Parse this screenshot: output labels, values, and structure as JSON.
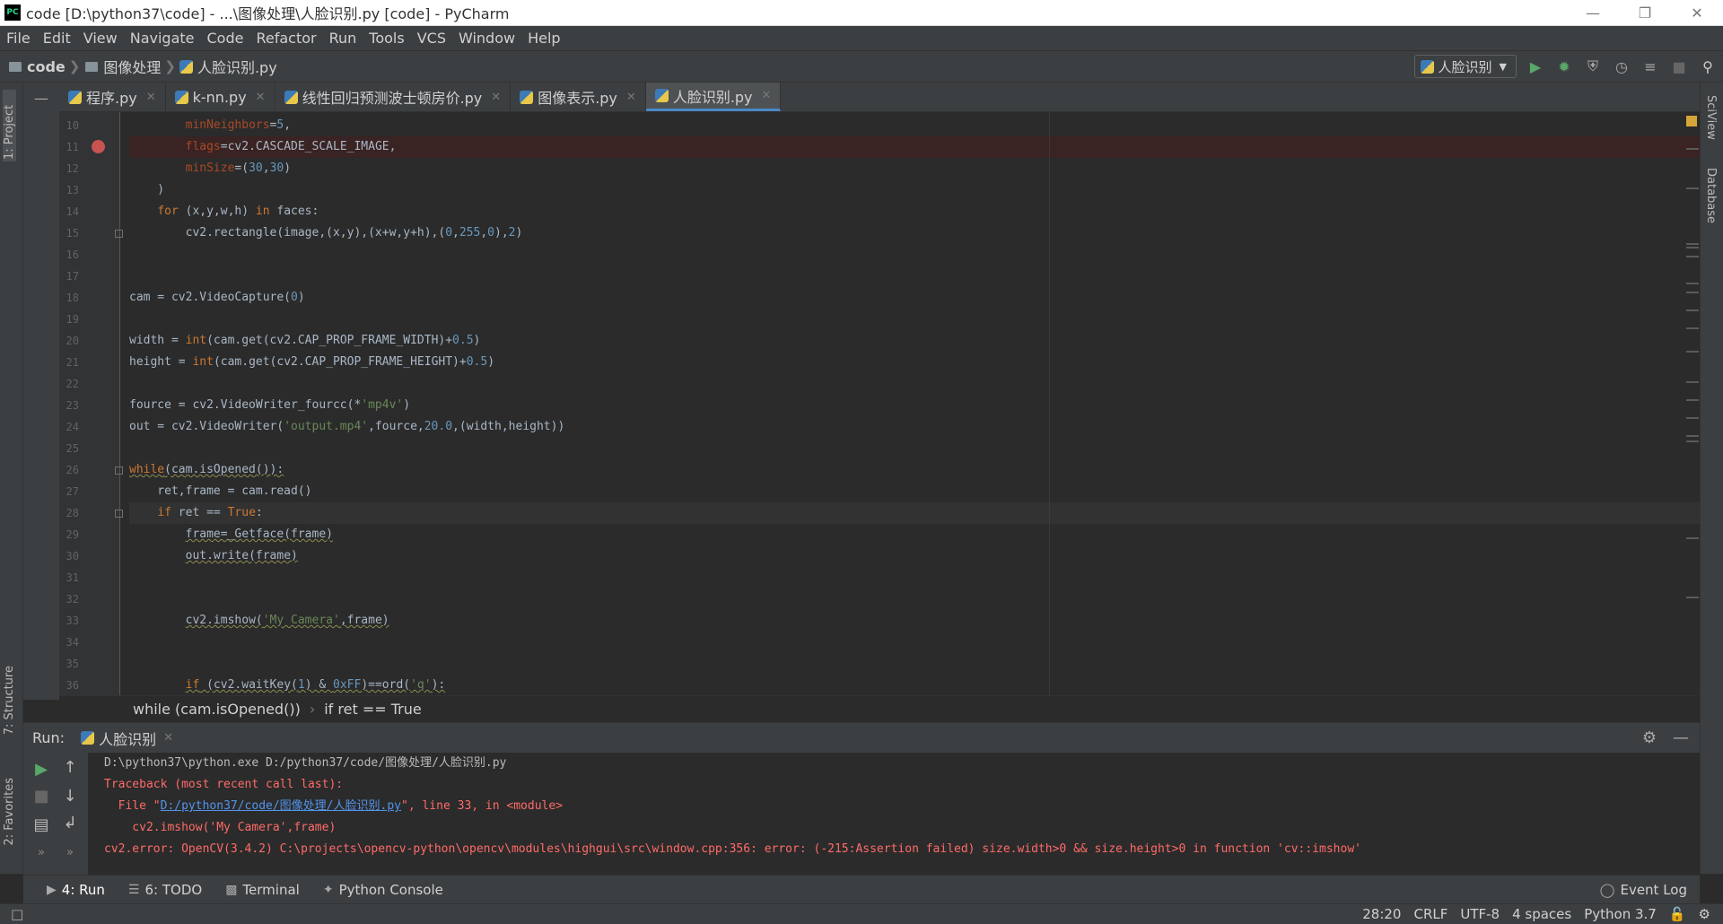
{
  "window": {
    "title": "code [D:\\python37\\code] - ...\\图像处理\\人脸识别.py [code] - PyCharm",
    "logo_text": "PC"
  },
  "menu": [
    "File",
    "Edit",
    "View",
    "Navigate",
    "Code",
    "Refactor",
    "Run",
    "Tools",
    "VCS",
    "Window",
    "Help"
  ],
  "nav": {
    "project": "code",
    "folder": "图像处理",
    "file": "人脸识别.py",
    "run_config": "人脸识别"
  },
  "left_tools": {
    "project": "1: Project",
    "structure": "7: Structure",
    "favorites": "2: Favorites"
  },
  "right_tools": {
    "sciview": "SciView",
    "database": "Database"
  },
  "tabs": [
    {
      "label": "程序.py",
      "active": false
    },
    {
      "label": "k-nn.py",
      "active": false
    },
    {
      "label": "线性回归预测波士顿房价.py",
      "active": false
    },
    {
      "label": "图像表示.py",
      "active": false
    },
    {
      "label": "人脸识别.py",
      "active": true
    }
  ],
  "editor": {
    "line_numbers": [
      "10",
      "11",
      "12",
      "13",
      "14",
      "15",
      "16",
      "17",
      "18",
      "19",
      "20",
      "21",
      "22",
      "23",
      "24",
      "25",
      "26",
      "27",
      "28",
      "29",
      "30",
      "31",
      "32",
      "33",
      "34",
      "35",
      "36"
    ],
    "lines": [
      "        minNeighbors=5,",
      "        flags=cv2.CASCADE_SCALE_IMAGE,",
      "        minSize=(30,30)",
      "    )",
      "    for (x,y,w,h) in faces:",
      "        cv2.rectangle(image,(x,y),(x+w,y+h),(0,255,0),2)",
      "",
      "",
      "cam = cv2.VideoCapture(0)",
      "",
      "width = int(cam.get(cv2.CAP_PROP_FRAME_WIDTH)+0.5)",
      "height = int(cam.get(cv2.CAP_PROP_FRAME_HEIGHT)+0.5)",
      "",
      "fource = cv2.VideoWriter_fourcc(*'mp4v')",
      "out = cv2.VideoWriter('output.mp4',fource,20.0,(width,height))",
      "",
      "while(cam.isOpened()):",
      "    ret,frame = cam.read()",
      "    if ret == True:",
      "        frame=_Getface(frame)",
      "        out.write(frame)",
      "",
      "",
      "        cv2.imshow('My Camera',frame)",
      "",
      "",
      "        if (cv2.waitKey(1) & 0xFF)==ord('q'):"
    ]
  },
  "breadcrumb": [
    "while (cam.isOpened())",
    "if ret == True"
  ],
  "run": {
    "label": "Run:",
    "tab": "人脸识别",
    "console": [
      "D:\\python37\\python.exe D:/python37/code/图像处理/人脸识别.py",
      "Traceback (most recent call last):",
      "  File \"",
      "D:/python37/code/图像处理/人脸识别.py",
      "\", line 33, in <module>",
      "    cv2.imshow('My Camera',frame)",
      "cv2.error: OpenCV(3.4.2) C:\\projects\\opencv-python\\opencv\\modules\\highgui\\src\\window.cpp:356: error: (-215:Assertion failed) size.width>0 && size.height>0 in function 'cv::imshow'"
    ]
  },
  "bottom_tools": [
    "4: Run",
    "6: TODO",
    "Terminal",
    "Python Console"
  ],
  "event_log": "Event Log",
  "status": {
    "position": "28:20",
    "line_sep": "CRLF",
    "encoding": "UTF-8",
    "indent": "4 spaces",
    "interpreter": "Python 3.7"
  },
  "colors": {
    "editor_bg": "#2b2b2b",
    "panel_bg": "#3c3f41",
    "keyword": "#cc7832",
    "number": "#6897bb",
    "string": "#6a8759",
    "error": "#ff6b68",
    "link": "#5394ec",
    "breakpoint": "#c75450"
  }
}
